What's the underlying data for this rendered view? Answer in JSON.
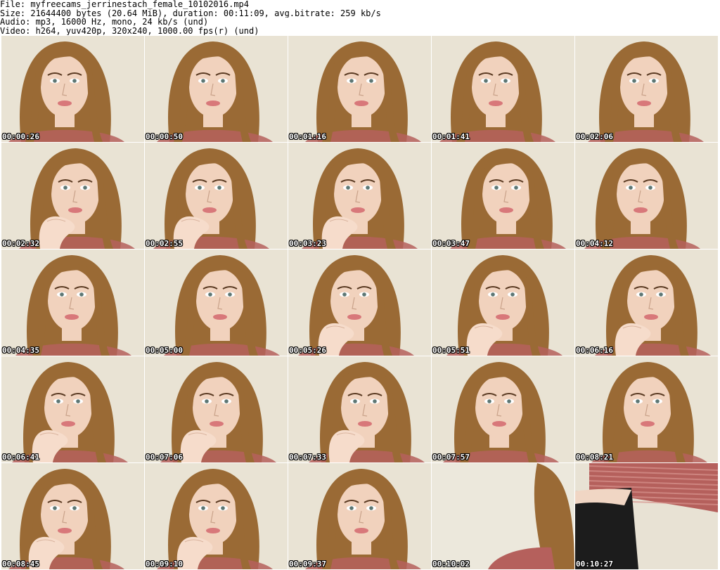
{
  "header": {
    "file_line": "File: myfreecams_jerrinestach_female_10102016.mp4",
    "size_line": "Size: 21644400 bytes (20.64 MiB), duration: 00:11:09, avg.bitrate: 259 kb/s",
    "audio_line": "Audio: mp3, 16000 Hz, mono, 24 kb/s (und)",
    "video_line": "Video: h264, yuv420p, 320x240, 1000.00 fps(r) (und)"
  },
  "thumbnails": [
    {
      "timestamp": "00:00:26",
      "scene": "face"
    },
    {
      "timestamp": "00:00:50",
      "scene": "face"
    },
    {
      "timestamp": "00:01:16",
      "scene": "face"
    },
    {
      "timestamp": "00:01:41",
      "scene": "face"
    },
    {
      "timestamp": "00:02:06",
      "scene": "face"
    },
    {
      "timestamp": "00:02:32",
      "scene": "face-hand"
    },
    {
      "timestamp": "00:02:55",
      "scene": "face-hand"
    },
    {
      "timestamp": "00:03:23",
      "scene": "face-hand"
    },
    {
      "timestamp": "00:03:47",
      "scene": "face"
    },
    {
      "timestamp": "00:04:12",
      "scene": "face"
    },
    {
      "timestamp": "00:04:35",
      "scene": "face"
    },
    {
      "timestamp": "00:05:00",
      "scene": "face"
    },
    {
      "timestamp": "00:05:26",
      "scene": "face-hand"
    },
    {
      "timestamp": "00:05:51",
      "scene": "face-hand"
    },
    {
      "timestamp": "00:06:16",
      "scene": "face-hand"
    },
    {
      "timestamp": "00:06:41",
      "scene": "face-hand"
    },
    {
      "timestamp": "00:07:06",
      "scene": "face-hand"
    },
    {
      "timestamp": "00:07:33",
      "scene": "face-hand"
    },
    {
      "timestamp": "00:07:57",
      "scene": "face"
    },
    {
      "timestamp": "00:08:21",
      "scene": "face"
    },
    {
      "timestamp": "00:08:45",
      "scene": "face-hand"
    },
    {
      "timestamp": "00:09:10",
      "scene": "face-hand"
    },
    {
      "timestamp": "00:09:37",
      "scene": "face"
    },
    {
      "timestamp": "00:10:02",
      "scene": "hair-shoulder"
    },
    {
      "timestamp": "00:10:27",
      "scene": "torso"
    }
  ],
  "colors": {
    "background": "#ffffff",
    "frame_wall": "#e9e3d4",
    "hair": "#9a6a35",
    "skin": "#f1d2bd",
    "lips": "#d8787a",
    "shirt": "#b5605c",
    "skirt": "#1c1c1c",
    "timestamp_text": "#ffffff"
  }
}
